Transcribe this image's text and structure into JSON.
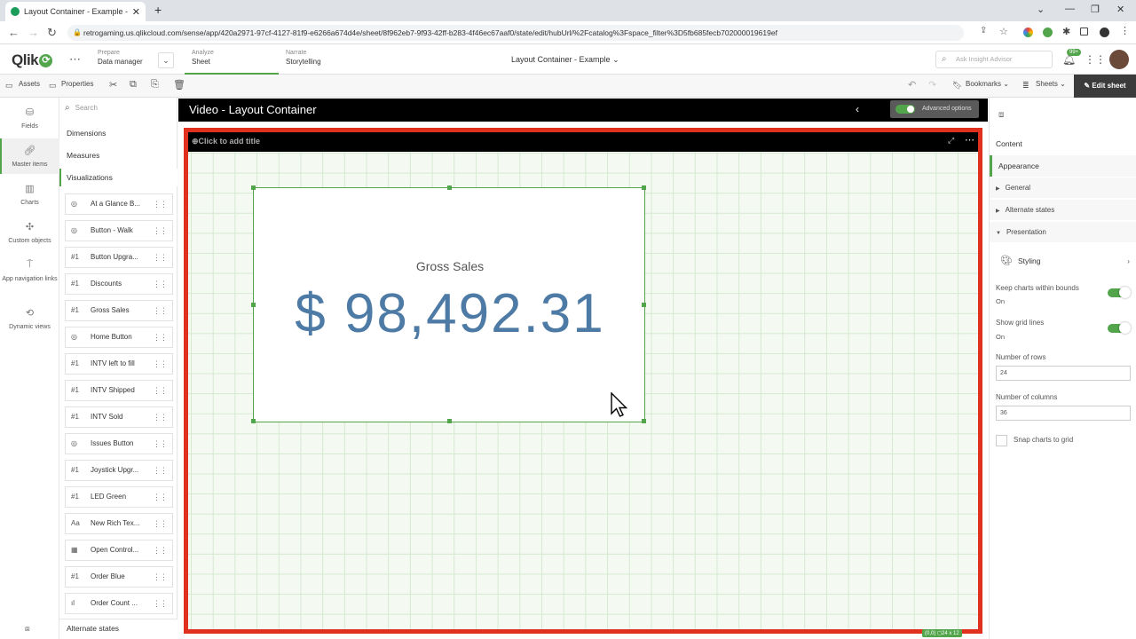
{
  "browser": {
    "tab_title": "Layout Container - Example - Vi",
    "tab_close": "✕",
    "new_tab": "+",
    "url": "retrogaming.us.qlikcloud.com/sense/app/420a2971-97cf-4127-81f9-e6266a674d4e/sheet/8f962eb7-9f93-42ff-b283-4f46ec67aaf0/state/edit/hubUrl/%2Fcatalog%3Fspace_filter%3D5fb685fecb702000019619ef"
  },
  "qlik": {
    "logo": "Qlik",
    "nav": [
      {
        "small": "Prepare",
        "big": "Data manager"
      },
      {
        "small": "Analyze",
        "big": "Sheet"
      },
      {
        "small": "Narrate",
        "big": "Storytelling"
      }
    ],
    "app_title": "Layout Container - Example",
    "ask_placeholder": "Ask Insight Advisor",
    "notif_badge": "99+"
  },
  "toolbar": {
    "assets": "Assets",
    "properties": "Properties",
    "bookmarks": "Bookmarks",
    "sheets": "Sheets",
    "edit_sheet": "Edit sheet"
  },
  "rail": [
    {
      "label": "Fields",
      "icon": "database-icon"
    },
    {
      "label": "Master items",
      "icon": "link-icon"
    },
    {
      "label": "Charts",
      "icon": "bar-chart-icon"
    },
    {
      "label": "Custom objects",
      "icon": "puzzle-icon"
    },
    {
      "label": "App navigation links",
      "icon": "signpost-icon"
    },
    {
      "label": "Dynamic views",
      "icon": "dynamic-view-icon"
    }
  ],
  "assets": {
    "search_placeholder": "Search",
    "categories": [
      "Dimensions",
      "Measures",
      "Visualizations"
    ],
    "items": [
      {
        "icon": "◎",
        "label": "At a Glance B..."
      },
      {
        "icon": "◎",
        "label": "Button - Walk"
      },
      {
        "icon": "#1",
        "label": "Button Upgra..."
      },
      {
        "icon": "#1",
        "label": "Discounts"
      },
      {
        "icon": "#1",
        "label": "Gross Sales"
      },
      {
        "icon": "◎",
        "label": "Home Button"
      },
      {
        "icon": "#1",
        "label": "INTV left to fill"
      },
      {
        "icon": "#1",
        "label": "INTV Shipped"
      },
      {
        "icon": "#1",
        "label": "INTV Sold"
      },
      {
        "icon": "◎",
        "label": "Issues Button"
      },
      {
        "icon": "#1",
        "label": "Joystick Upgr..."
      },
      {
        "icon": "#1",
        "label": "LED Green"
      },
      {
        "icon": "Aa",
        "label": "New Rich Tex..."
      },
      {
        "icon": "▦",
        "label": "Open Control..."
      },
      {
        "icon": "#1",
        "label": "Order Blue"
      },
      {
        "icon": "ıl",
        "label": "Order Count ..."
      }
    ],
    "alternate_states": "Alternate states"
  },
  "sheet": {
    "title": "Video - Layout Container",
    "advanced_options": "Advanced options",
    "container_title": "Click to add title",
    "container_info": "(0,0) ◻24 x 12"
  },
  "kpi": {
    "label": "Gross Sales",
    "value": "$ 98,492.31"
  },
  "props": {
    "tabs": [
      "Content",
      "Appearance"
    ],
    "sections": [
      "General",
      "Alternate states",
      "Presentation"
    ],
    "styling": "Styling",
    "keep_within_bounds_label": "Keep charts within bounds",
    "keep_within_bounds_value": "On",
    "show_grid_label": "Show grid lines",
    "show_grid_value": "On",
    "rows_label": "Number of rows",
    "rows_value": "24",
    "cols_label": "Number of columns",
    "cols_value": "36",
    "snap_label": "Snap charts to grid"
  },
  "colors": {
    "accent": "#52a54b",
    "container_border": "#e0301e",
    "kpi_value": "#4e7ba5"
  }
}
